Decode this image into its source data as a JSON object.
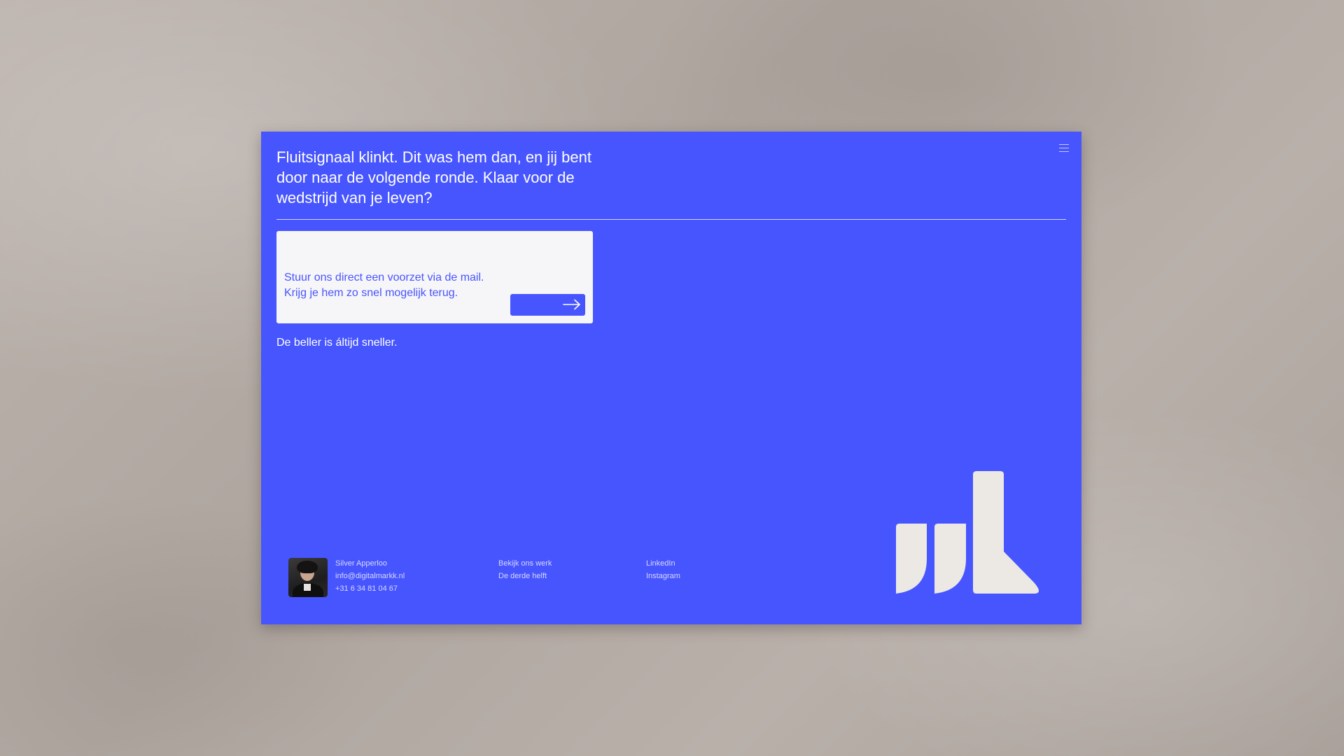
{
  "hero": {
    "headline": "Fluitsignaal klinkt. Dit was hem dan, en jij bent door naar de volgende ronde. Klaar voor de wedstrijd van je leven?"
  },
  "mail_box": {
    "text": "Stuur ons direct een voorzet via de mail. Krijg je hem zo snel mogelijk terug."
  },
  "caller_text": "De beller is áltijd sneller.",
  "footer": {
    "contact": {
      "name": "Silver Apperloo",
      "email": "info@digitalmarkk.nl",
      "phone": "+31 6 34 81 04 67"
    },
    "work_links": [
      "Bekijk ons werk",
      "De derde helft"
    ],
    "social_links": [
      "LinkedIn",
      "Instagram"
    ]
  },
  "colors": {
    "card": "#4755ff",
    "background": "#b5aca6",
    "mail_box": "#f6f5f8",
    "logo": "#ece9e4"
  },
  "icons": {
    "menu": "hamburger-icon",
    "button": "arrow-right-icon"
  }
}
